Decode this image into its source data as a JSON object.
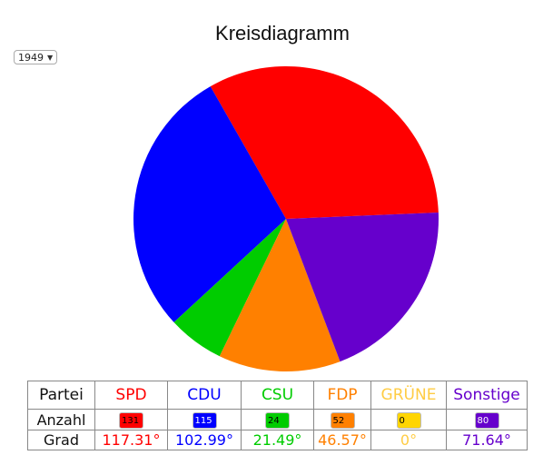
{
  "chart_data": {
    "type": "pie",
    "title": "Kreisdiagramm",
    "year_selector": "1949",
    "row_labels": [
      "Partei",
      "Anzahl",
      "Grad"
    ],
    "categories": [
      "SPD",
      "CDU",
      "CSU",
      "FDP",
      "GRÜNE",
      "Sonstige"
    ],
    "values": [
      131,
      115,
      24,
      52,
      0,
      80
    ],
    "degrees": [
      "117.31°",
      "102.99°",
      "21.49°",
      "46.57°",
      "0°",
      "71.64°"
    ],
    "colors": [
      "#ff0000",
      "#0000ff",
      "#00cc00",
      "#ff8000",
      "#ffd500",
      "#6600cc"
    ],
    "label_colors": [
      "#ff0000",
      "#0000ff",
      "#00cc00",
      "#ff8000",
      "#ffcc44",
      "#6600cc"
    ],
    "chip_text_colors": [
      "#000000",
      "#ffffff",
      "#000000",
      "#000000",
      "#000000",
      "#ffffff"
    ],
    "start_angle_deg": 2.4,
    "direction": "counterclockwise"
  }
}
